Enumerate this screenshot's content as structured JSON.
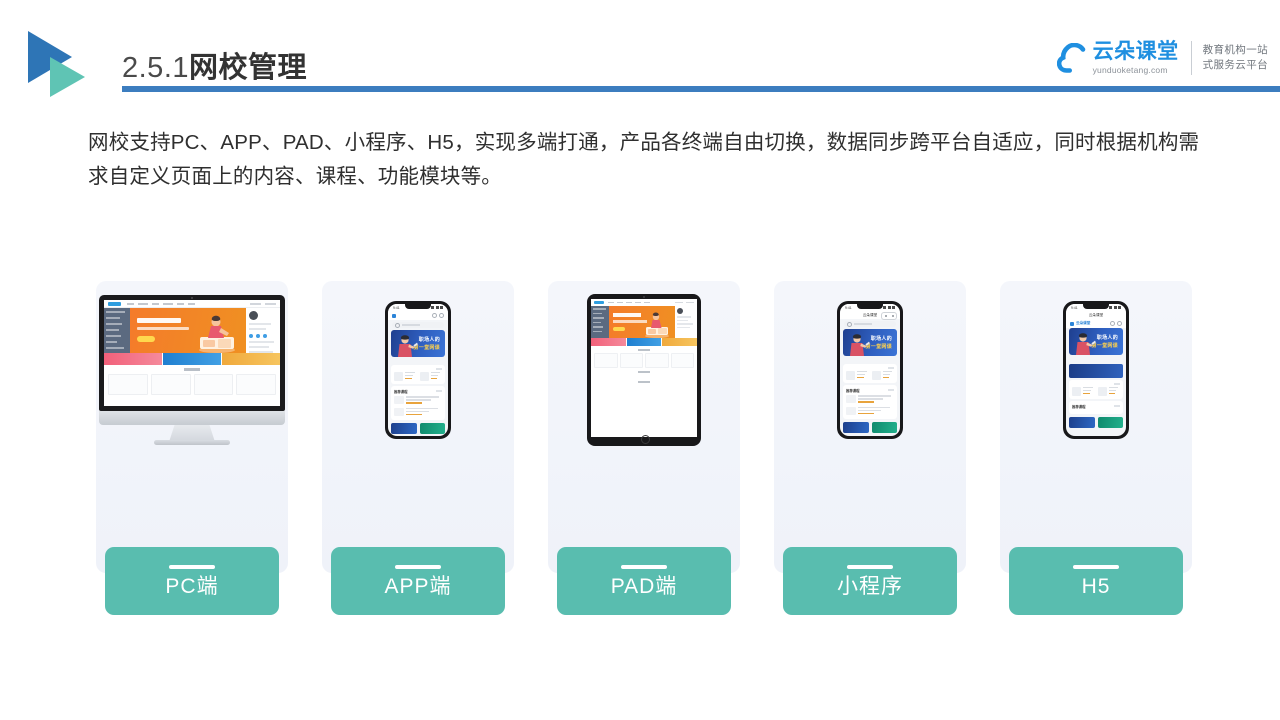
{
  "header": {
    "section_number": "2.5.1",
    "title_zh": "网校管理",
    "logo_icon": "double-triangle-play-icon"
  },
  "brand": {
    "cloud_icon": "cloud-icon",
    "name_cn": "云朵课堂",
    "url": "yunduoketang.com",
    "tagline_line1": "教育机构一站",
    "tagline_line2": "式服务云平台"
  },
  "content": {
    "paragraph": "网校支持PC、APP、PAD、小程序、H5，实现多端打通，产品各终端自由切换，数据同步跨平台自适应，同时根据机构需求自定义页面上的内容、课程、功能模块等。"
  },
  "cards": [
    {
      "id": "pc",
      "label": "PC端",
      "device": "desktop-monitor",
      "preview": {
        "hero_color": "#F47B2A",
        "sidebar_color": "#5B6A80",
        "section_caption": "公开课"
      }
    },
    {
      "id": "app",
      "label": "APP端",
      "device": "smartphone",
      "preview": {
        "banner_title_line1": "职场人的",
        "banner_title_line2": "第一堂网课",
        "banner_color": "#2F5FC0",
        "highlight_color": "#FFD24D",
        "section_caption": "推荐课程"
      }
    },
    {
      "id": "pad",
      "label": "PAD端",
      "device": "tablet",
      "preview": {
        "hero_color": "#F47B2A",
        "sidebar_color": "#5B6A80",
        "section_caption": "精品课程"
      }
    },
    {
      "id": "miniprogram",
      "label": "小程序",
      "device": "smartphone",
      "preview": {
        "app_bar_title": "云朵课堂",
        "banner_title_line1": "职场人的",
        "banner_title_line2": "第一堂网课",
        "banner_color": "#2F5FC0",
        "highlight_color": "#FFD24D",
        "section_caption": "推荐课程"
      }
    },
    {
      "id": "h5",
      "label": "H5",
      "device": "smartphone",
      "preview": {
        "app_bar_title": "云朵课堂",
        "banner_title_line1": "职场人的",
        "banner_title_line2": "第一堂网课",
        "banner_color": "#2F5FC0",
        "highlight_color": "#FFD24D",
        "section_caption": "推荐课程"
      }
    }
  ],
  "colors": {
    "accent_blue": "#3C7DBF",
    "logo_blue": "#2E75B6",
    "logo_teal": "#5FC4B4",
    "pill_teal": "#59BDAF",
    "card_bg": "#F1F4FA",
    "brand_blue": "#1F8FE0"
  }
}
